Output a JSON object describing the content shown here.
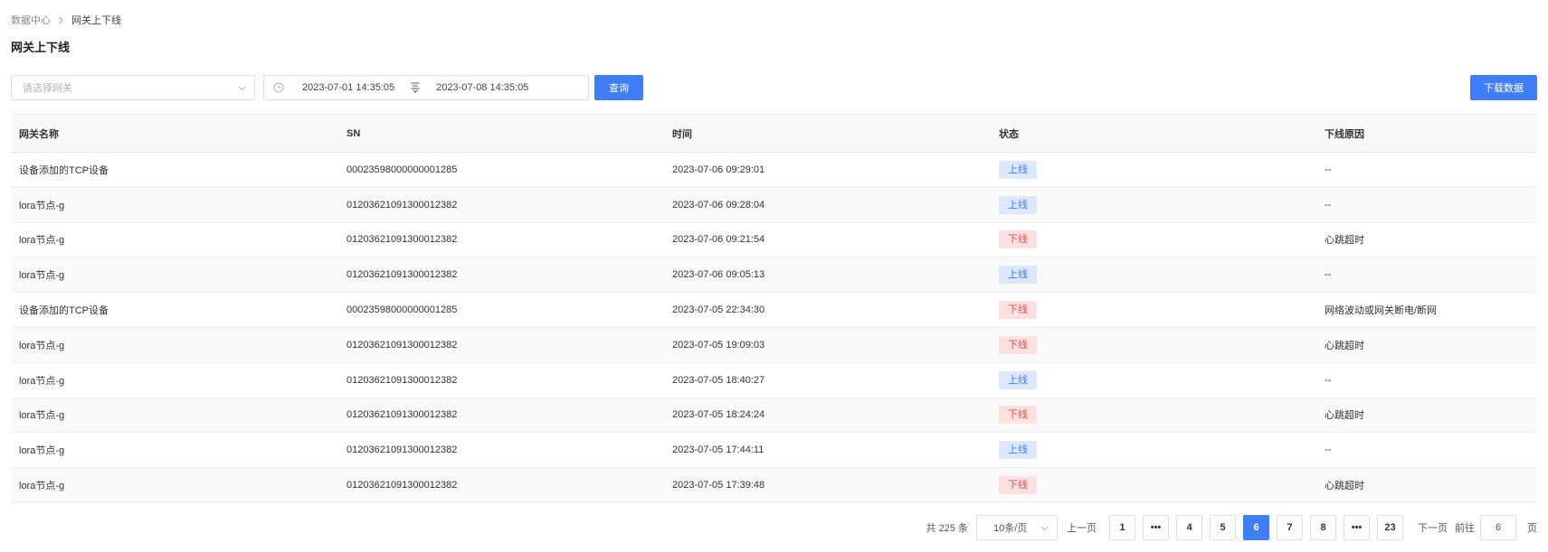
{
  "breadcrumb": {
    "parent": "数据中心",
    "current": "网关上下线"
  },
  "title": "网关上下线",
  "filters": {
    "gateway_placeholder": "请选择网关",
    "start_time": "2023-07-01 14:35:05",
    "end_time": "2023-07-08 14:35:05",
    "query_label": "查询",
    "download_label": "下载数据"
  },
  "table": {
    "columns": [
      "网关名称",
      "SN",
      "时间",
      "状态",
      "下线原因"
    ],
    "rows": [
      {
        "name": "设备添加的TCP设备",
        "sn": "00023598000000001285",
        "time": "2023-07-06 09:29:01",
        "status": "上线",
        "status_type": "online",
        "reason": "--"
      },
      {
        "name": "lora节点-g",
        "sn": "01203621091300012382",
        "time": "2023-07-06 09:28:04",
        "status": "上线",
        "status_type": "online",
        "reason": "--"
      },
      {
        "name": "lora节点-g",
        "sn": "01203621091300012382",
        "time": "2023-07-06 09:21:54",
        "status": "下线",
        "status_type": "offline",
        "reason": "心跳超时"
      },
      {
        "name": "lora节点-g",
        "sn": "01203621091300012382",
        "time": "2023-07-06 09:05:13",
        "status": "上线",
        "status_type": "online",
        "reason": "--"
      },
      {
        "name": "设备添加的TCP设备",
        "sn": "00023598000000001285",
        "time": "2023-07-05 22:34:30",
        "status": "下线",
        "status_type": "offline",
        "reason": "网络波动或网关断电/断网"
      },
      {
        "name": "lora节点-g",
        "sn": "01203621091300012382",
        "time": "2023-07-05 19:09:03",
        "status": "下线",
        "status_type": "offline",
        "reason": "心跳超时"
      },
      {
        "name": "lora节点-g",
        "sn": "01203621091300012382",
        "time": "2023-07-05 18:40:27",
        "status": "上线",
        "status_type": "online",
        "reason": "--"
      },
      {
        "name": "lora节点-g",
        "sn": "01203621091300012382",
        "time": "2023-07-05 18:24:24",
        "status": "下线",
        "status_type": "offline",
        "reason": "心跳超时"
      },
      {
        "name": "lora节点-g",
        "sn": "01203621091300012382",
        "time": "2023-07-05 17:44:11",
        "status": "上线",
        "status_type": "online",
        "reason": "--"
      },
      {
        "name": "lora节点-g",
        "sn": "01203621091300012382",
        "time": "2023-07-05 17:39:48",
        "status": "下线",
        "status_type": "offline",
        "reason": "心跳超时"
      }
    ]
  },
  "pagination": {
    "total": "共 225 条",
    "page_size": "10条/页",
    "prev": "上一页",
    "pages": [
      "1",
      "•••",
      "4",
      "5",
      "6",
      "7",
      "8",
      "•••",
      "23"
    ],
    "current": "6",
    "next": "下一页",
    "goto_label": "前往",
    "goto_value": "6",
    "page_suffix": "页"
  },
  "colors": {
    "primary": "#3f7ef7",
    "online_bg": "#dde8fc",
    "offline_bg": "#fde0e0",
    "offline_text": "#e8504d"
  },
  "icons": {
    "breadcrumb_separator": "chevron-right-icon",
    "select_arrow": "chevron-down-icon",
    "date_prefix": "clock-icon",
    "range_separator": "range-separator-icon"
  }
}
